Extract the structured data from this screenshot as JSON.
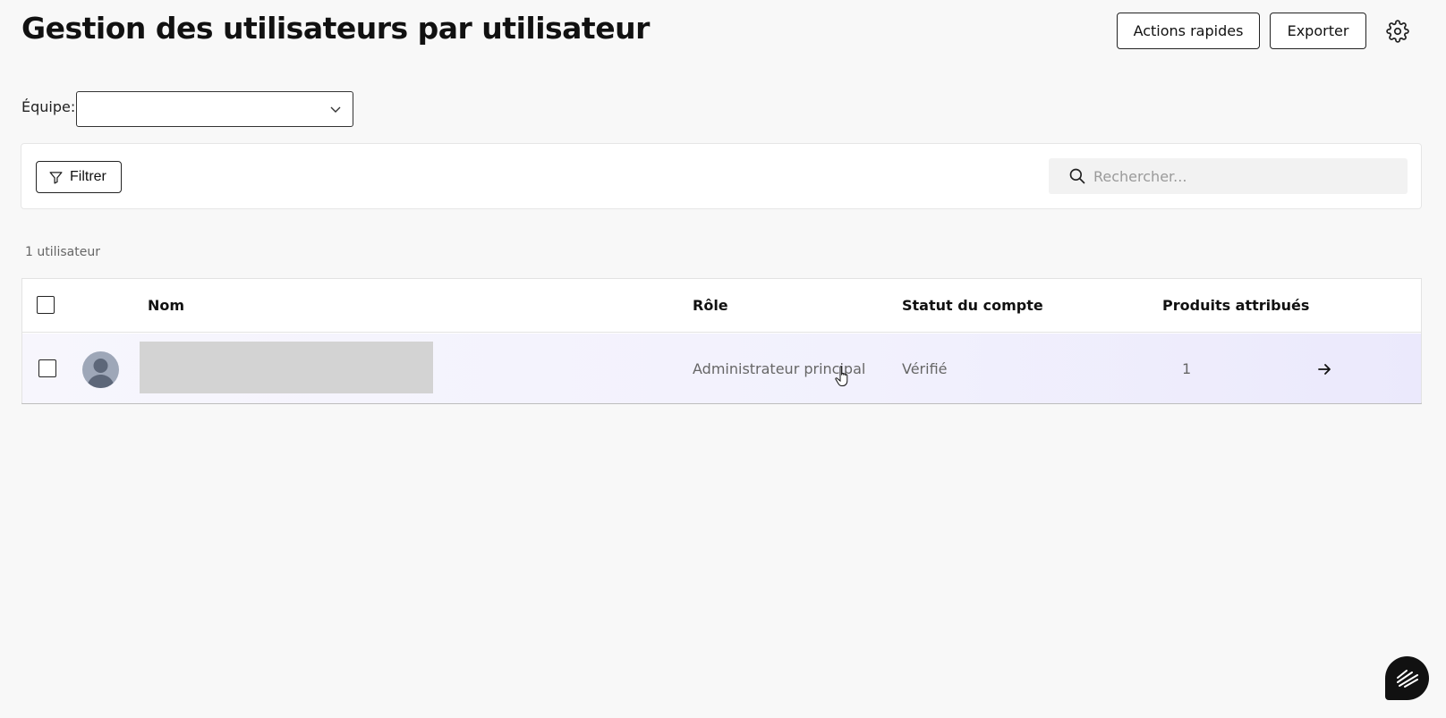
{
  "header": {
    "title": "Gestion des utilisateurs par utilisateur",
    "actions_label": "Actions rapides",
    "export_label": "Exporter",
    "settings_icon": "gear-icon"
  },
  "team_filter": {
    "label": "Équipe:",
    "value": "",
    "icon": "chevron-down-icon"
  },
  "toolbar": {
    "filter_label": "Filtrer",
    "filter_icon": "funnel-icon",
    "search_placeholder": "Rechercher...",
    "search_icon": "search-icon"
  },
  "user_count": "1 utilisateur",
  "table": {
    "columns": [
      "Nom",
      "Rôle",
      "Statut du compte",
      "Produits attribués"
    ],
    "rows": [
      {
        "name": "",
        "role": "Administrateur principal",
        "status": "Vérifié",
        "products": "1",
        "avatar_icon": "user-avatar-icon",
        "open_icon": "arrow-right-icon"
      }
    ]
  },
  "fab_icon": "chat-assistant-icon",
  "colors": {
    "background": "#f8f8f8",
    "row_hover": "#f2f1fd",
    "fab": "#111111"
  }
}
